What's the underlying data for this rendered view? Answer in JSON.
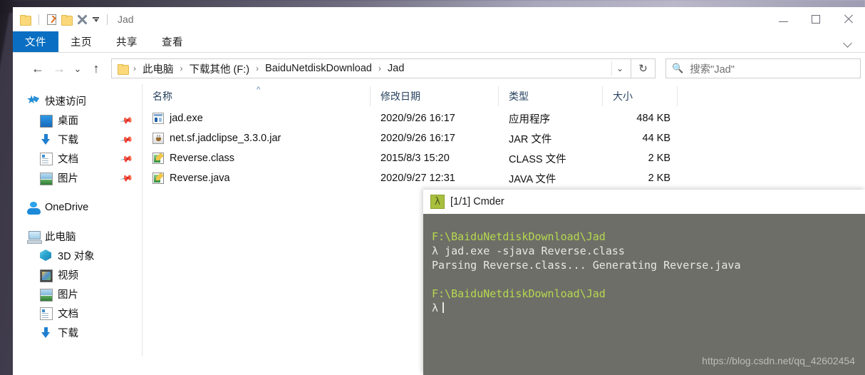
{
  "window": {
    "title": "Jad",
    "quick_access": [
      {
        "name": "folder-icon",
        "label": "文件夹"
      },
      {
        "name": "properties-icon",
        "label": "属性"
      },
      {
        "name": "new-folder-icon",
        "label": "新建文件夹"
      },
      {
        "name": "delete-icon",
        "label": "删除"
      },
      {
        "name": "customize-dropdown-icon",
        "label": "自定义快速访问工具栏"
      }
    ],
    "controls": {
      "minimize": "—",
      "maximize": "☐",
      "close": "✕"
    }
  },
  "ribbon": {
    "tabs": [
      {
        "label": "文件",
        "active": true
      },
      {
        "label": "主页",
        "active": false
      },
      {
        "label": "共享",
        "active": false
      },
      {
        "label": "查看",
        "active": false
      }
    ],
    "expand_icon": "chevron-down-icon"
  },
  "address": {
    "back_icon": "←",
    "forward_icon": "→",
    "recent_icon": "⌄",
    "up_icon": "↑",
    "crumbs": [
      "此电脑",
      "下载其他 (F:)",
      "BaiduNetdiskDownload",
      "Jad"
    ],
    "separator": "›",
    "dropdown_icon": "⌄",
    "refresh_icon": "↻",
    "search_icon": "⌕",
    "search_placeholder": "搜索\"Jad\""
  },
  "sidebar": {
    "items": [
      {
        "label": "快速访问",
        "icon": "quick-access-star-icon",
        "level": 0,
        "pinned": false
      },
      {
        "label": "桌面",
        "icon": "desktop-icon",
        "level": 1,
        "pinned": true
      },
      {
        "label": "下载",
        "icon": "downloads-icon",
        "level": 1,
        "pinned": true
      },
      {
        "label": "文档",
        "icon": "documents-icon",
        "level": 1,
        "pinned": true
      },
      {
        "label": "图片",
        "icon": "pictures-icon",
        "level": 1,
        "pinned": true
      },
      {
        "label": "OneDrive",
        "icon": "onedrive-cloud-icon",
        "level": 0,
        "pinned": false
      },
      {
        "label": "此电脑",
        "icon": "this-pc-icon",
        "level": 0,
        "pinned": false
      },
      {
        "label": "3D 对象",
        "icon": "3d-objects-icon",
        "level": 1,
        "pinned": false
      },
      {
        "label": "视频",
        "icon": "videos-icon",
        "level": 1,
        "pinned": false
      },
      {
        "label": "图片",
        "icon": "pictures-icon",
        "level": 1,
        "pinned": false
      },
      {
        "label": "文档",
        "icon": "documents-icon",
        "level": 1,
        "pinned": false
      },
      {
        "label": "下载",
        "icon": "downloads-icon",
        "level": 1,
        "pinned": false
      }
    ],
    "pin_icon": "pin-icon"
  },
  "filelist": {
    "columns": [
      {
        "key": "name",
        "label": "名称"
      },
      {
        "key": "date",
        "label": "修改日期"
      },
      {
        "key": "type",
        "label": "类型"
      },
      {
        "key": "size",
        "label": "大小"
      }
    ],
    "sort_indicator": "^",
    "rows": [
      {
        "name": "jad.exe",
        "date": "2020/9/26 16:17",
        "type": "应用程序",
        "size": "484 KB",
        "icon": "exe-file-icon"
      },
      {
        "name": "net.sf.jadclipse_3.3.0.jar",
        "date": "2020/9/26 16:17",
        "type": "JAR 文件",
        "size": "44 KB",
        "icon": "jar-file-icon"
      },
      {
        "name": "Reverse.class",
        "date": "2015/8/3 15:20",
        "type": "CLASS 文件",
        "size": "2 KB",
        "icon": "java-file-icon"
      },
      {
        "name": "Reverse.java",
        "date": "2020/9/27 12:31",
        "type": "JAVA 文件",
        "size": "2 KB",
        "icon": "java-file-icon"
      }
    ]
  },
  "terminal": {
    "tab_label": "[1/1] Cmder",
    "tab_icon": "λ",
    "lines": [
      {
        "text": "F:\\BaiduNetdiskDownload\\Jad",
        "kind": "path"
      },
      {
        "text": "λ jad.exe -sjava Reverse.class",
        "kind": "prompt"
      },
      {
        "text": "Parsing Reverse.class... Generating Reverse.java",
        "kind": "output"
      },
      {
        "text": "",
        "kind": "blank"
      },
      {
        "text": "F:\\BaiduNetdiskDownload\\Jad",
        "kind": "path"
      },
      {
        "text": "λ",
        "kind": "cursor"
      }
    ],
    "watermark": "https://blog.csdn.net/qq_42602454",
    "colors": {
      "background": "#6e6e68",
      "path": "#b5d94f",
      "text": "#e8e8e4",
      "accent": "#a8c03e"
    }
  }
}
